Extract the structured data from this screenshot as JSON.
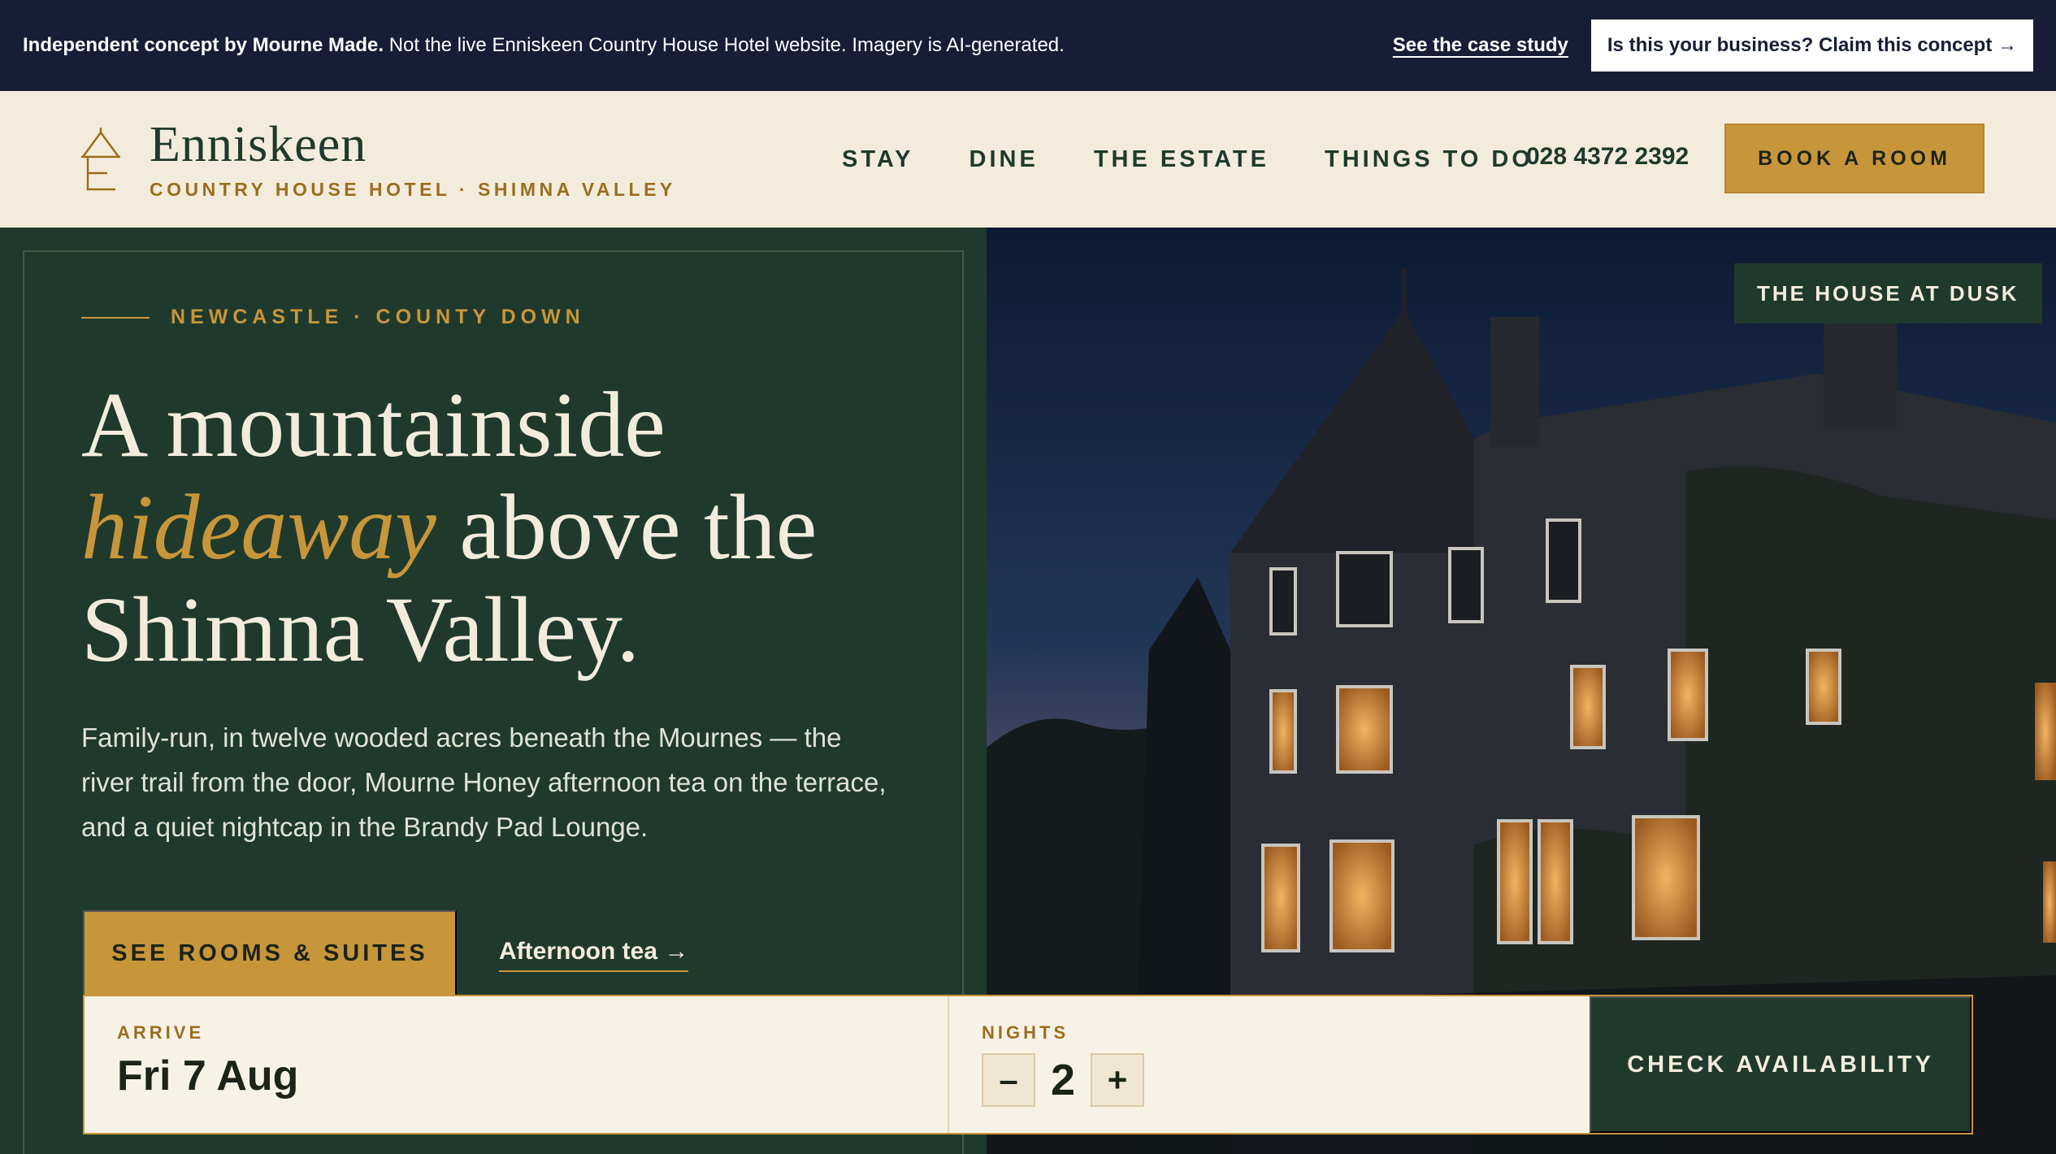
{
  "banner": {
    "bold_text": "Independent concept by Mourne Made.",
    "text": " Not the live Enniskeen Country House Hotel website. Imagery is AI-generated.",
    "case_study_link": "See the case study",
    "claim_button": "Is this your business? Claim this concept →"
  },
  "header": {
    "brand_name": "Enniskeen",
    "brand_subtitle": "COUNTRY HOUSE HOTEL · SHIMNA VALLEY",
    "nav": [
      "STAY",
      "DINE",
      "THE ESTATE",
      "THINGS TO DO"
    ],
    "phone": "028 4372 2392",
    "book_button": "BOOK A ROOM"
  },
  "hero": {
    "eyebrow": "NEWCASTLE · COUNTY DOWN",
    "headline_line1": "A mountainside",
    "headline_em": "hideaway",
    "headline_line2_rest": " above the",
    "headline_line3": "Shimna Valley.",
    "lede": "Family-run, in twelve wooded acres beneath the Mournes — the river trail from the door, Mourne Honey afternoon tea on the terrace, and a quiet nightcap in the Brandy Pad Lounge.",
    "primary_cta": "SEE ROOMS & SUITES",
    "secondary_link": "Afternoon tea →",
    "image_tag": "THE HOUSE AT DUSK"
  },
  "booking": {
    "arrive_label": "ARRIVE",
    "arrive_value": "Fri 7 Aug",
    "nights_label": "NIGHTS",
    "nights_value": "2",
    "minus_label": "–",
    "plus_label": "+",
    "check_button": "CHECK AVAILABILITY"
  },
  "colors": {
    "banner_bg": "#171d36",
    "cream": "#f3ecdd",
    "forest_green": "#1f3a2c",
    "gold": "#c8963a"
  }
}
